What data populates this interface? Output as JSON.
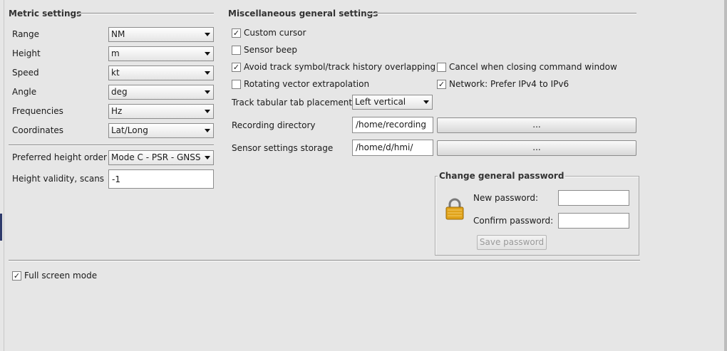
{
  "metric": {
    "title": "Metric settings",
    "rows": [
      {
        "label": "Range",
        "value": "NM"
      },
      {
        "label": "Height",
        "value": "m"
      },
      {
        "label": "Speed",
        "value": "kt"
      },
      {
        "label": "Angle",
        "value": "deg"
      },
      {
        "label": "Frequencies",
        "value": "Hz"
      },
      {
        "label": "Coordinates",
        "value": "Lat/Long"
      }
    ],
    "preferred_height_order": {
      "label": "Preferred height order",
      "value": "Mode C - PSR - GNSS"
    },
    "height_validity": {
      "label": "Height validity, scans",
      "value": "-1"
    }
  },
  "misc": {
    "title": "Miscellaneous general settings",
    "custom_cursor": {
      "label": "Custom cursor",
      "checked": true
    },
    "sensor_beep": {
      "label": "Sensor beep",
      "checked": false
    },
    "avoid_overlap": {
      "label": "Avoid track symbol/track history overlapping",
      "checked": true
    },
    "cancel_closing": {
      "label": "Cancel when closing command window",
      "checked": false
    },
    "rotating_vector": {
      "label": "Rotating vector extrapolation",
      "checked": false
    },
    "network_ipv4": {
      "label": "Network: Prefer IPv4 to IPv6",
      "checked": true
    },
    "tab_placement": {
      "label": "Track tabular tab placement",
      "value": "Left vertical"
    },
    "recording_dir": {
      "label": "Recording directory",
      "value": "/home/recording",
      "button": "..."
    },
    "sensor_storage": {
      "label": "Sensor settings storage",
      "value": "/home/d/hmi/",
      "button": "..."
    }
  },
  "password": {
    "title": "Change general password",
    "new_label": "New password:",
    "confirm_label": "Confirm password:",
    "new_value": "",
    "confirm_value": "",
    "save_button": "Save password",
    "icon": "lock-icon"
  },
  "full_screen": {
    "label": "Full screen mode",
    "checked": true
  },
  "check_mark": "✓"
}
